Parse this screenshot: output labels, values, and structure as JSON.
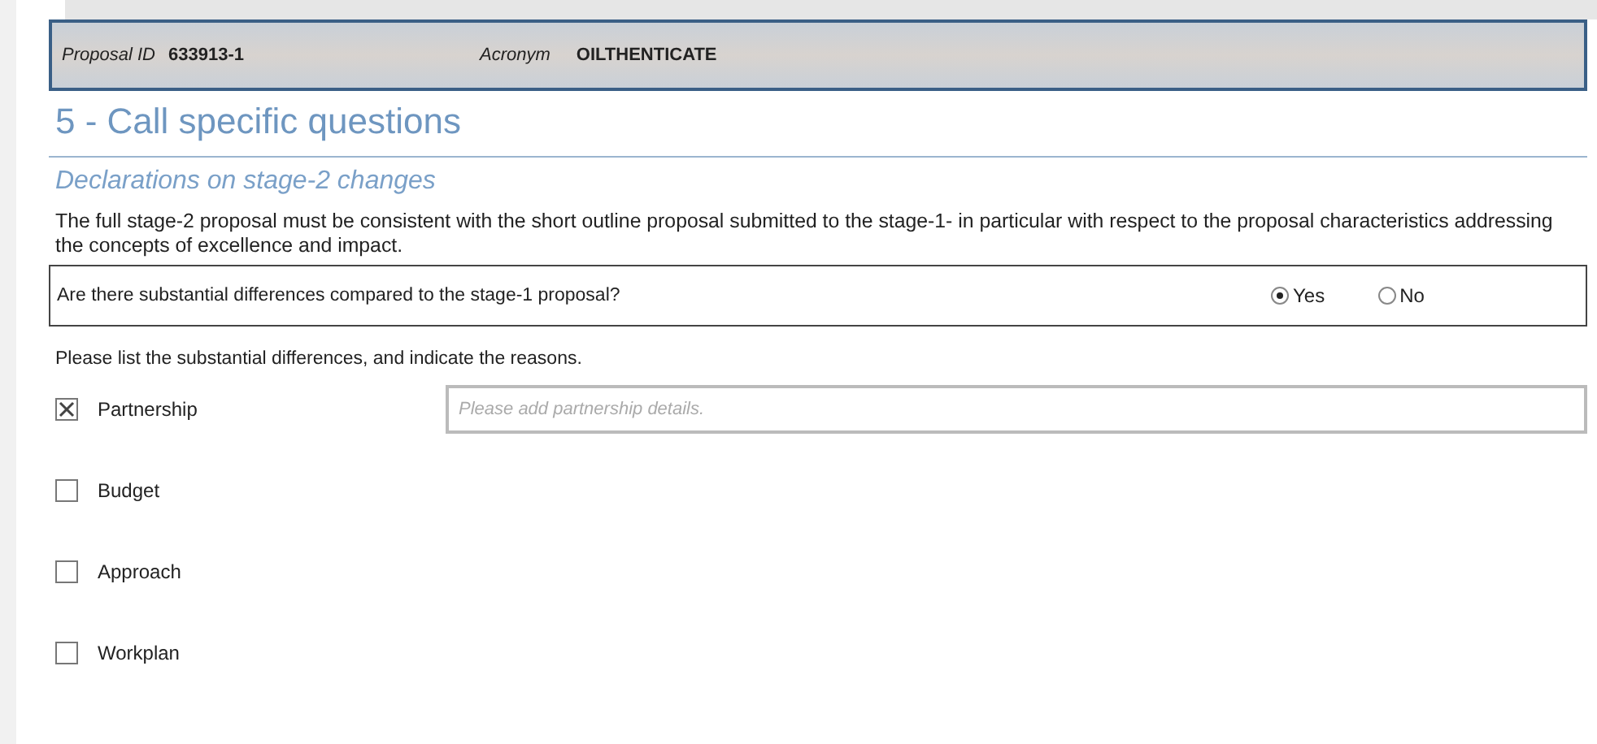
{
  "header": {
    "proposal_id_label": "Proposal ID",
    "proposal_id": "633913-1",
    "acronym_label": "Acronym",
    "acronym": "OILTHENTICATE"
  },
  "title": "5 - Call specific questions",
  "subtitle": "Declarations on stage-2 changes",
  "intro": "The full stage-2 proposal must be consistent with the short outline proposal submitted to the stage-1- in particular with respect to the proposal characteristics addressing the concepts of excellence and impact.",
  "question": {
    "text": "Are there substantial differences compared to the stage-1 proposal?",
    "options": [
      {
        "label": "Yes",
        "selected": true
      },
      {
        "label": "No",
        "selected": false
      }
    ]
  },
  "instruction": "Please list the substantial differences, and indicate the reasons.",
  "items": [
    {
      "label": "Partnership",
      "checked": true,
      "placeholder": "Please add partnership details."
    },
    {
      "label": "Budget",
      "checked": false
    },
    {
      "label": "Approach",
      "checked": false
    },
    {
      "label": "Workplan",
      "checked": false
    }
  ]
}
